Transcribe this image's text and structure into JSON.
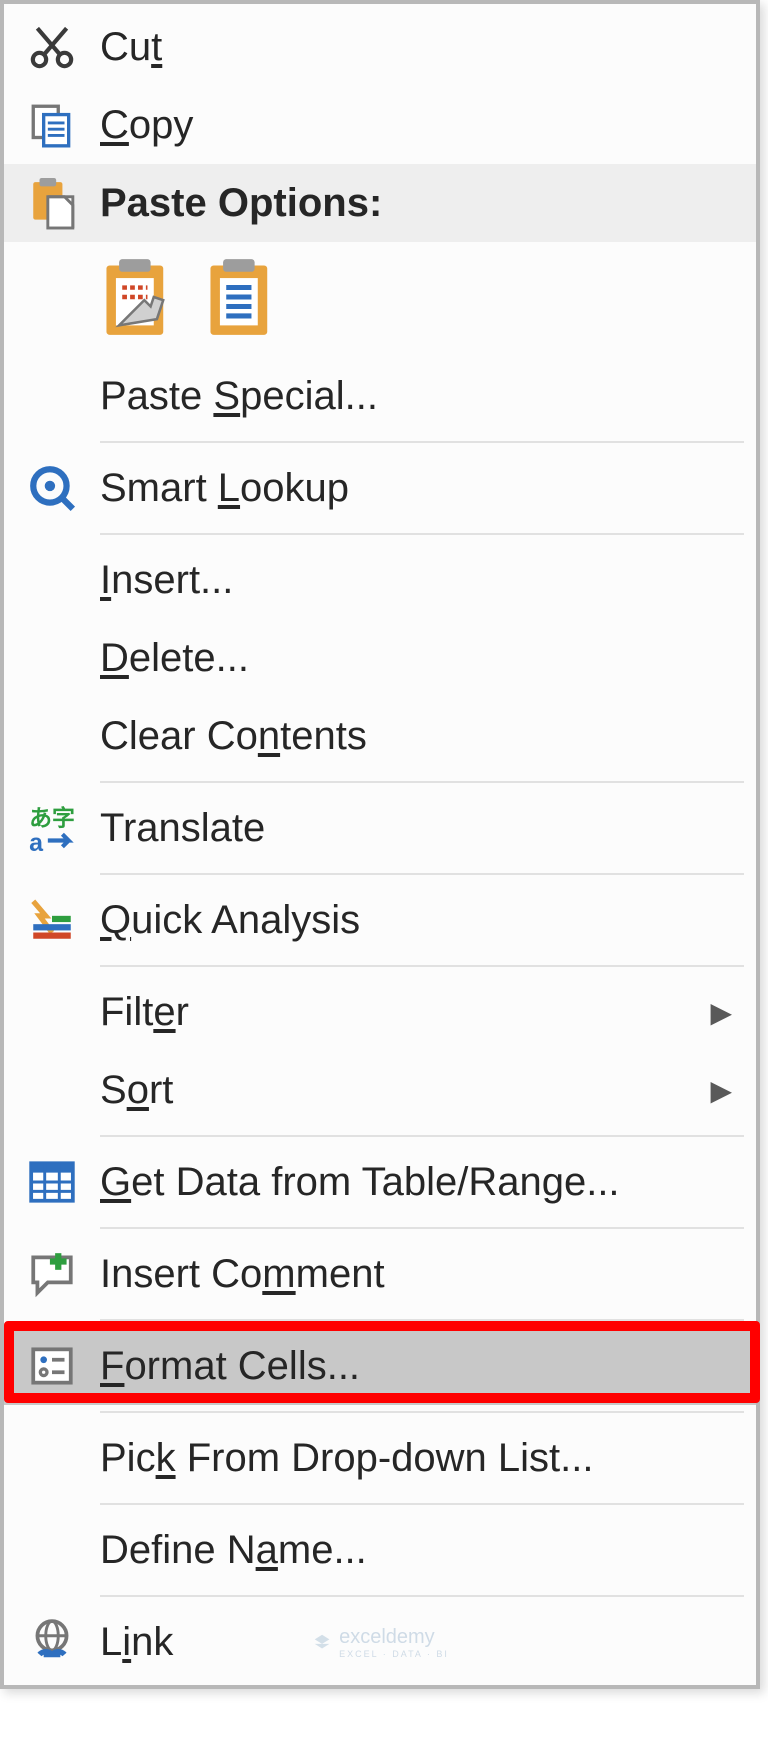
{
  "menu": {
    "cut": "Cut",
    "copy": "Copy",
    "paste_options_header": "Paste Options:",
    "paste_special": "Paste Special...",
    "smart_lookup": "Smart Lookup",
    "insert": "Insert...",
    "delete": "Delete...",
    "clear_contents": "Clear Contents",
    "translate": "Translate",
    "quick_analysis": "Quick Analysis",
    "filter": "Filter",
    "sort": "Sort",
    "get_data": "Get Data from Table/Range...",
    "insert_comment": "Insert Comment",
    "format_cells": "Format Cells...",
    "pick_list": "Pick From Drop-down List...",
    "define_name": "Define Name...",
    "link": "Link"
  },
  "watermark": {
    "text": "exceldemy",
    "sub": "EXCEL · DATA · BI"
  }
}
